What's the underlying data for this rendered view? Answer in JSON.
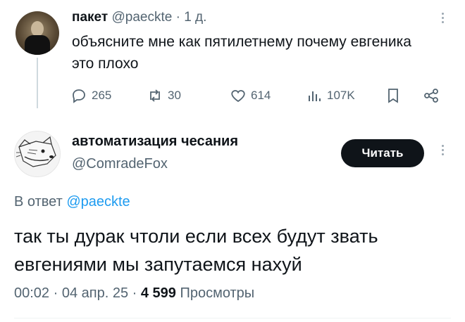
{
  "tweet": {
    "author_name": "пакет",
    "author_handle": "@paeckte",
    "time": "· 1 д.",
    "text": "объясните мне как пятилетнему почему евгеника это плохо",
    "actions": {
      "replies": "265",
      "retweets": "30",
      "likes": "614",
      "views": "107K"
    }
  },
  "reply": {
    "author_name": "автоматизация чесания",
    "author_handle": "@ComradeFox",
    "follow_label": "Читать",
    "reply_prefix": "В ответ",
    "reply_handle": "@paeckte",
    "text": "так ты дурак чтоли если всех будут звать евгениями мы запутаемся нахуй",
    "timestamp": "00:02 · 04 апр. 25 ·",
    "views_count": "4 599",
    "views_label": "Просмотры"
  },
  "colors": {
    "accent": "#1d9bf0",
    "text": "#0f1419",
    "muted": "#536471"
  },
  "icons": [
    "reply-icon",
    "retweet-icon",
    "like-icon",
    "views-icon",
    "bookmark-icon",
    "share-icon",
    "more-icon"
  ]
}
